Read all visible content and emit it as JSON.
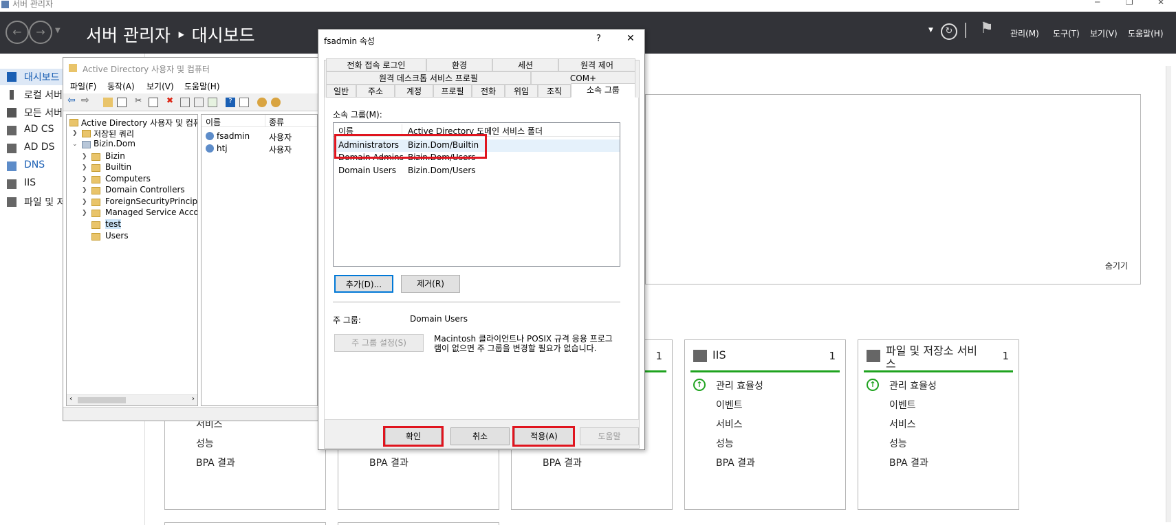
{
  "window": {
    "title": "서버 관리자"
  },
  "header": {
    "title": "서버 관리자 ‣ 대시보드",
    "menus": [
      "관리(M)",
      "도구(T)",
      "보기(V)",
      "도움말(H)"
    ]
  },
  "sidebar": {
    "items": [
      {
        "label": "대시보드"
      },
      {
        "label": "로컬 서버"
      },
      {
        "label": "모든 서버"
      },
      {
        "label": "AD CS"
      },
      {
        "label": "AD DS"
      },
      {
        "label": "DNS"
      },
      {
        "label": "IIS"
      },
      {
        "label": "파일 및 저"
      }
    ]
  },
  "dashboard": {
    "hide_label": "숨기기",
    "tiles": [
      {
        "title": "",
        "count": "",
        "rows": [
          "서비스",
          "성능",
          "BPA 결과"
        ]
      },
      {
        "title": "",
        "count": "",
        "rows": [
          "BPA 결과"
        ]
      },
      {
        "title": "",
        "count": "1",
        "rows": [
          "BPA 결과"
        ]
      },
      {
        "title": "IIS",
        "count": "1",
        "rows": [
          "관리 효율성",
          "이벤트",
          "서비스",
          "성능",
          "BPA 결과"
        ]
      },
      {
        "title": "파일 및 저장소 서비\n스",
        "count": "1",
        "rows": [
          "관리 효율성",
          "이벤트",
          "서비스",
          "성능",
          "BPA 결과"
        ]
      }
    ]
  },
  "aduc": {
    "title": "Active Directory 사용자 및 컴퓨터",
    "menu": [
      "파일(F)",
      "동작(A)",
      "보기(V)",
      "도움말(H)"
    ],
    "tree": [
      {
        "label": "Active Directory 사용자 및 컴퓨터",
        "level": 0
      },
      {
        "label": "저장된 쿼리",
        "level": 1
      },
      {
        "label": "Bizin.Dom",
        "level": 1
      },
      {
        "label": "Bizin",
        "level": 2
      },
      {
        "label": "Builtin",
        "level": 2
      },
      {
        "label": "Computers",
        "level": 2
      },
      {
        "label": "Domain Controllers",
        "level": 2
      },
      {
        "label": "ForeignSecurityPrincipal",
        "level": 2
      },
      {
        "label": "Managed Service Accou",
        "level": 2
      },
      {
        "label": "test",
        "level": 2
      },
      {
        "label": "Users",
        "level": 2
      }
    ],
    "list_headers": [
      "이름",
      "종류"
    ],
    "list": [
      {
        "name": "fsadmin",
        "type": "사용자"
      },
      {
        "name": "htj",
        "type": "사용자"
      }
    ]
  },
  "dialog": {
    "title": "fsadmin 속성",
    "help_glyph": "?",
    "close_glyph": "✕",
    "tabs_row1": [
      "전화 접속 로그인",
      "환경",
      "세션",
      "원격 제어"
    ],
    "tabs_row2": [
      "원격 데스크톱 서비스 프로필",
      "COM+"
    ],
    "tabs_row3": [
      "일반",
      "주소",
      "계정",
      "프로필",
      "전화",
      "위임",
      "조직",
      "소속 그룹"
    ],
    "member_of_label": "소속 그룹(M):",
    "columns": [
      "이름",
      "Active Directory 도메인 서비스 폴더"
    ],
    "groups": [
      {
        "name": "Administrators",
        "folder": "Bizin.Dom/Builtin"
      },
      {
        "name": "Domain Admins",
        "folder": "Bizin.Dom/Users"
      },
      {
        "name": "Domain Users",
        "folder": "Bizin.Dom/Users"
      }
    ],
    "add_button": "추가(D)...",
    "remove_button": "제거(R)",
    "primary_group_label": "주 그룹:",
    "primary_group_value": "Domain Users",
    "set_primary_button": "주 그룹 설정(S)",
    "note": "Macintosh 클라이언트나 POSIX 규격 응용 프로그\n램이 없으면 주 그룹을 변경할 필요가 없습니다.",
    "ok": "확인",
    "cancel": "취소",
    "apply": "적용(A)",
    "help": "도움말"
  },
  "colors": {
    "header_bg": "#323338",
    "accent": "#1a5fb4",
    "ok_green": "#1fa31f",
    "highlight_red": "#e0141e"
  }
}
